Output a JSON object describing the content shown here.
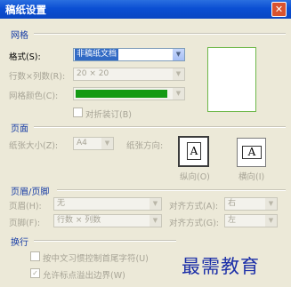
{
  "window": {
    "title": "稿纸设置"
  },
  "grid": {
    "section": "网格",
    "format_label": "格式(S):",
    "format_value": "非稿纸文档",
    "rows_cols_label": "行数×列数(R):",
    "rows_cols_value": "20 × 20",
    "grid_color_label": "网格颜色(C):",
    "grid_color": "#149a14",
    "fold_label": "对折装订(B)"
  },
  "page": {
    "section": "页面",
    "size_label": "纸张大小(Z):",
    "size_value": "A4",
    "orient_label": "纸张方向:",
    "portrait_label": "纵向(O)",
    "landscape_label": "横向(I)"
  },
  "header_footer": {
    "section": "页眉/页脚",
    "header_label": "页眉(H):",
    "header_value": "无",
    "header_align_label": "对齐方式(A):",
    "header_align_value": "右",
    "footer_label": "页脚(F):",
    "footer_value": "行数 × 列数",
    "footer_align_label": "对齐方式(G):",
    "footer_align_value": "左"
  },
  "wrap": {
    "section": "换行",
    "opt1_label": "按中文习惯控制首尾字符(U)",
    "opt2_label": "允许标点溢出边界(W)",
    "opt1_checked": false,
    "opt2_checked": true
  },
  "watermark": "最需教育"
}
